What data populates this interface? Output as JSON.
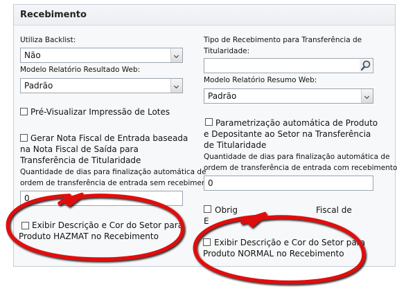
{
  "section": {
    "title": "Recebimento"
  },
  "left": {
    "blacklist_label": "Utiliza Backlist:",
    "blacklist_value": "Não",
    "report_web_label": "Modelo Relatório Resultado Web:",
    "report_web_value": "Padrão",
    "preview_label": "Pré-Visualizar Impressão de Lotes",
    "nf_line1": "Gerar Nota Fiscal de Entrada baseada",
    "nf_line2": "na Nota Fiscal de Saída para",
    "nf_line3": "Transferência de Titularidade",
    "days_line1": "Quantidade de dias para finalização automática de",
    "days_line2": "ordem de transferência de entrada sem recebimentos:",
    "days_value": "0",
    "hazmat_line1": "Exibir Descrição e Cor do Setor para",
    "hazmat_line2": "Produto HAZMAT no Recebimento"
  },
  "right": {
    "type_label_line1": "Tipo de Recebimento para Transferência de",
    "type_label_line2": "Titularidade:",
    "type_value": "",
    "summary_label": "Modelo Relatório Resumo Web:",
    "summary_value": "Padrão",
    "param_line1": "Parametrização automática de Produto",
    "param_line2": "e Depositante ao Setor na Transferência",
    "param_line3": "de Titularidade",
    "days_line1": "Quantidade de dias para finalização automática de",
    "days_line2": "ordem de transferência de entrada com recebimentos:",
    "days_value": "0",
    "oblig_part1": "Obrig",
    "oblig_part2": "Fiscal de",
    "oblig_part3": "E",
    "normal_line1": "Exibir Descrição e Cor do Setor para",
    "normal_line2": "Produto NORMAL no Recebimento"
  },
  "icons": {
    "search": "magnifier-icon",
    "dropdown": "chevron-down-icon",
    "annotation": "red-ellipse-marker"
  },
  "colors": {
    "annotation_red": "#e01010",
    "annotation_shadow": "#000000",
    "panel_border": "#c3ccd6"
  }
}
